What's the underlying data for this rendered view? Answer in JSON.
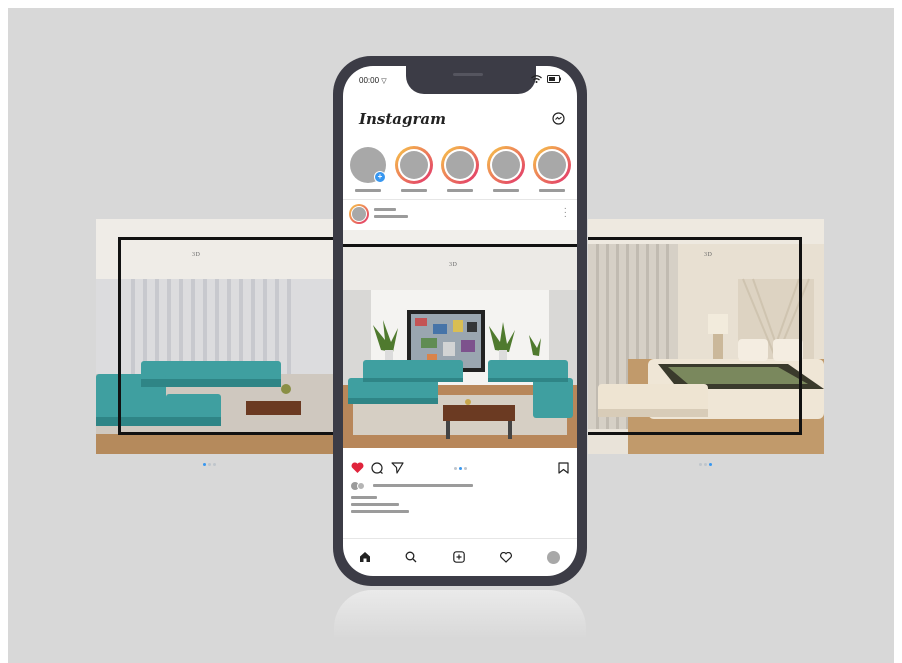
{
  "status_bar": {
    "time": "00:00"
  },
  "app": {
    "title": "Instagram"
  },
  "watermark": {
    "text": "3D"
  },
  "stories": {
    "count": 5
  },
  "carousel": {
    "slides": 3,
    "active_slide_center": 2,
    "active_slide_left": 1,
    "active_slide_right": 3
  },
  "post": {
    "liked": true
  },
  "colors": {
    "accent": "#3897f0",
    "like": "#e0243c",
    "phone_frame": "#3c3c46",
    "sofa": "#3f9fa0"
  },
  "nav": [
    "home-icon",
    "search-icon",
    "create-icon",
    "activity-icon",
    "profile-avatar"
  ]
}
